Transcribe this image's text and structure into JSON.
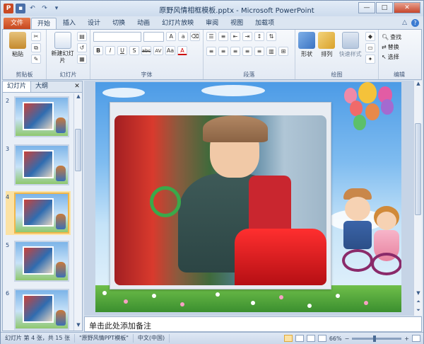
{
  "window": {
    "title": "原野风情相框模板.pptx - Microsoft PowerPoint",
    "min": "—",
    "max": "□",
    "close": "✕"
  },
  "tabs": [
    "文件",
    "开始",
    "插入",
    "设计",
    "切换",
    "动画",
    "幻灯片放映",
    "审阅",
    "视图",
    "加载项"
  ],
  "ribbon": {
    "clipboard": {
      "paste": "粘贴",
      "label": "剪贴板"
    },
    "slides": {
      "new_slide": "新建幻灯片",
      "label": "幻灯片"
    },
    "font": {
      "label": "字体",
      "bold": "B",
      "italic": "I",
      "underline": "U",
      "strike": "S",
      "shadow": "abc",
      "spacing": "AV",
      "case": "Aa",
      "color": "A"
    },
    "paragraph": {
      "label": "段落"
    },
    "drawing": {
      "shape": "形状",
      "arrange": "排列",
      "quick_styles": "快速样式",
      "label": "绘图"
    },
    "editing": {
      "find": "查找",
      "replace": "替换",
      "select": "选择",
      "label": "编辑"
    }
  },
  "left_pane": {
    "tab_slides": "幻灯片",
    "tab_outline": "大纲",
    "close": "✕",
    "thumbnails": [
      {
        "num": "2",
        "selected": false
      },
      {
        "num": "3",
        "selected": false
      },
      {
        "num": "4",
        "selected": true
      },
      {
        "num": "5",
        "selected": false
      },
      {
        "num": "6",
        "selected": false
      }
    ]
  },
  "notes": {
    "placeholder": "单击此处添加备注"
  },
  "status": {
    "slide_info": "幻灯片 第 4 张，共 15 张",
    "theme": "\"原野风情PPT模板\"",
    "language": "中文(中国)",
    "zoom": "66%"
  }
}
